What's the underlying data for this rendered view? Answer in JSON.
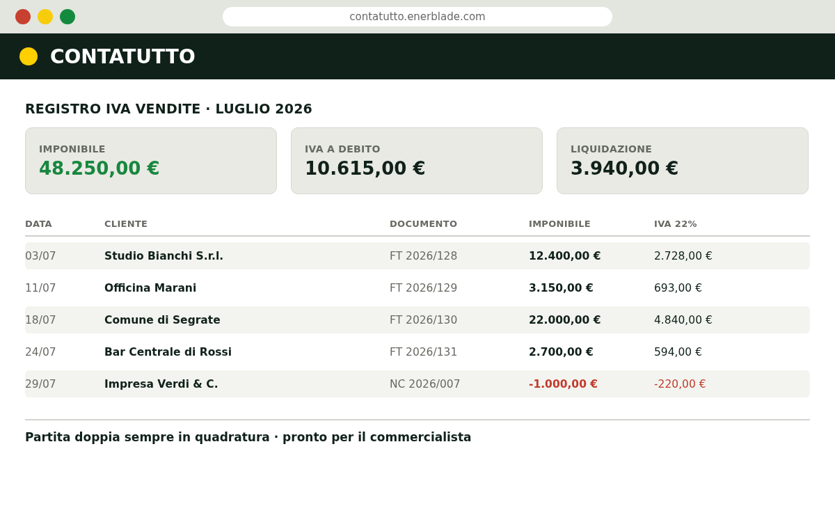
{
  "browser": {
    "url": "contatutto.enerblade.com"
  },
  "header": {
    "title": "CONTATUTTO"
  },
  "page": {
    "title": "REGISTRO IVA VENDITE · LUGLIO 2026"
  },
  "summary_cards": [
    {
      "label": "IMPONIBILE",
      "value": "48.250,00 €",
      "color": "#17873f"
    },
    {
      "label": "IVA A DEBITO",
      "value": "10.615,00 €",
      "color": "#10211a"
    },
    {
      "label": "LIQUIDAZIONE",
      "value": "3.940,00 €",
      "color": "#10211a"
    }
  ],
  "table": {
    "columns": [
      "DATA",
      "CLIENTE",
      "DOCUMENTO",
      "IMPONIBILE",
      "IVA 22%"
    ],
    "rows": [
      {
        "date": "03/07",
        "client": "Studio Bianchi S.r.l.",
        "document": "FT 2026/128",
        "taxable": "12.400,00 €",
        "vat": "2.728,00 €",
        "negative": false
      },
      {
        "date": "11/07",
        "client": "Officina Marani",
        "document": "FT 2026/129",
        "taxable": "3.150,00 €",
        "vat": "693,00 €",
        "negative": false
      },
      {
        "date": "18/07",
        "client": "Comune di Segrate",
        "document": "FT 2026/130",
        "taxable": "22.000,00 €",
        "vat": "4.840,00 €",
        "negative": false
      },
      {
        "date": "24/07",
        "client": "Bar Centrale di Rossi",
        "document": "FT 2026/131",
        "taxable": "2.700,00 €",
        "vat": "594,00 €",
        "negative": false
      },
      {
        "date": "29/07",
        "client": "Impresa Verdi & C.",
        "document": "NC 2026/007",
        "taxable": "-1.000,00 €",
        "vat": "-220,00 €",
        "negative": true
      }
    ]
  },
  "footer": {
    "text": "Partita doppia sempre in quadratura · pronto per il commercialista"
  }
}
